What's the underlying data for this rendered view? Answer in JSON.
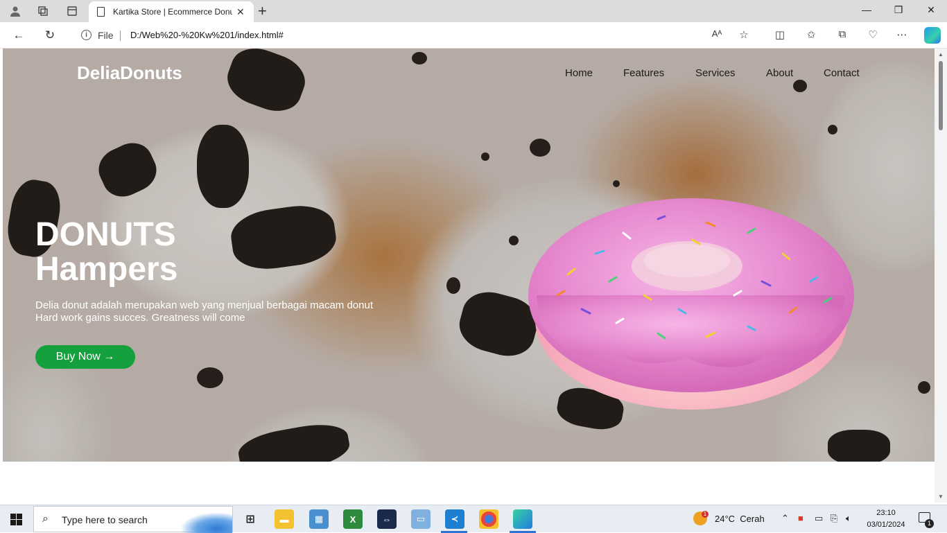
{
  "browser": {
    "tab_title": "Kartika Store | Ecommerce Donut",
    "tab_close": "✕",
    "new_tab": "+",
    "address_scheme_label": "File",
    "url": "D:/Web%20-%20Kw%201/index.html#"
  },
  "site": {
    "brand": "DeliaDonuts",
    "nav": [
      "Home",
      "Features",
      "Services",
      "About",
      "Contact"
    ],
    "hero": {
      "title_line1": "DONUTS",
      "title_line2": "Hampers",
      "desc_line1": "Delia donut adalah merupakan web yang menjual berbagai macam donut",
      "desc_line2": "Hard work gains succes. Greatness will come",
      "cta": "Buy Now →"
    },
    "colors": {
      "cta": "#14a03c",
      "donut_glaze": "#e78ad0"
    }
  },
  "taskbar": {
    "search_placeholder": "Type here to search",
    "weather_temp": "24°C",
    "weather_text": "Cerah",
    "time": "23:10",
    "date": "03/01/2024",
    "notification_count": "1",
    "weather_alert": "1"
  }
}
